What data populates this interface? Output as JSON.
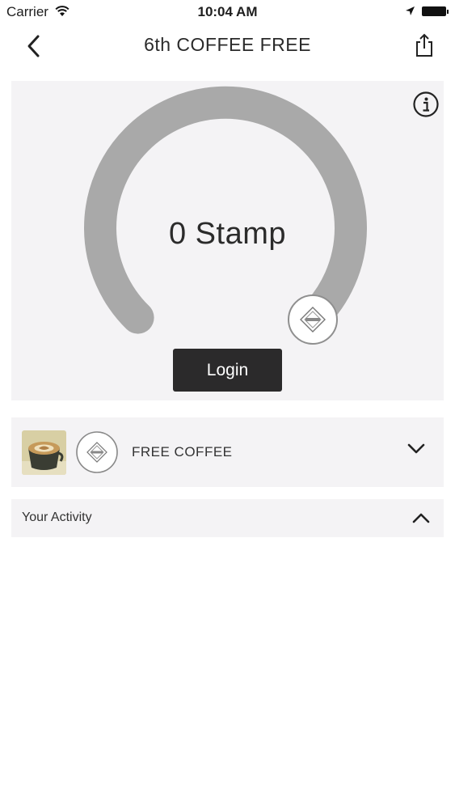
{
  "status_bar": {
    "carrier": "Carrier",
    "time": "10:04 AM"
  },
  "nav": {
    "title": "6th COFFEE FREE",
    "back_icon": "chevron-left-icon",
    "share_icon": "share-icon"
  },
  "stamp_card": {
    "stamp_text": "0 Stamp",
    "stamps_collected": 0,
    "login_label": "Login",
    "info_icon": "info-icon",
    "badge_icon": "shop-logo-badge-icon",
    "arc_color": "#a9a9a9"
  },
  "reward": {
    "label": "FREE COFFEE",
    "thumbnail_icon": "coffee-cup-thumbnail",
    "expanded": false
  },
  "activity": {
    "label": "Your Activity",
    "expanded": true
  },
  "colors": {
    "card_background": "#f4f3f5",
    "button_dark": "#2b2a2b",
    "text_dark": "#2b2b2b"
  }
}
